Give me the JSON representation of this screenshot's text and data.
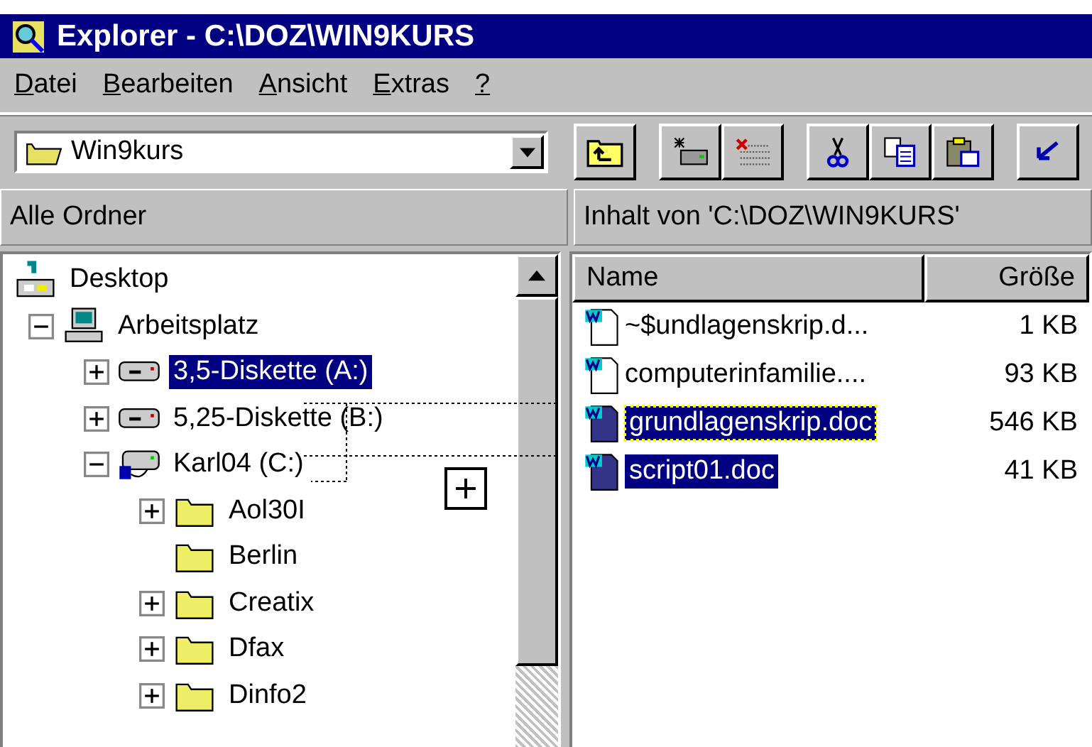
{
  "window": {
    "title": "Explorer - C:\\DOZ\\WIN9KURS"
  },
  "menu": [
    {
      "accelerator": "D",
      "rest": "atei"
    },
    {
      "accelerator": "B",
      "rest": "earbeiten"
    },
    {
      "accelerator": "A",
      "rest": "nsicht"
    },
    {
      "accelerator": "E",
      "rest": "xtras"
    },
    {
      "accelerator": "?"
    }
  ],
  "address": {
    "value": "Win9kurs"
  },
  "tree_header": "Alle Ordner",
  "content_header": "Inhalt von 'C:\\DOZ\\WIN9KURS'",
  "tree": [
    {
      "label": "Desktop",
      "kind": "desktop",
      "selected": false,
      "children": [
        {
          "label": "Arbeitsplatz",
          "kind": "computer",
          "selected": false,
          "expanded": true,
          "children": [
            {
              "label": "3,5-Diskette (A:)",
              "kind": "floppy",
              "selected": true,
              "expanded": false
            },
            {
              "label": "5,25-Diskette (B:)",
              "kind": "floppy",
              "selected": false,
              "expanded": false
            },
            {
              "label": "Karl04 (C:)",
              "kind": "harddisk",
              "selected": false,
              "expanded": true,
              "children": [
                {
                  "label": "Aol30I",
                  "kind": "folder",
                  "selected": false,
                  "expanded": false
                },
                {
                  "label": "Berlin",
                  "kind": "folder",
                  "selected": false
                },
                {
                  "label": "Creatix",
                  "kind": "folder",
                  "selected": false,
                  "expanded": false
                },
                {
                  "label": "Dfax",
                  "kind": "folder",
                  "selected": false,
                  "expanded": false
                },
                {
                  "label": "Dinfo2",
                  "kind": "folder",
                  "selected": false,
                  "expanded": false
                }
              ]
            }
          ]
        }
      ]
    }
  ],
  "columns": [
    "Name",
    "Größe"
  ],
  "files": [
    {
      "name": "~$undlagenskrip.d...",
      "size": "1 KB",
      "selected": false,
      "focused": false
    },
    {
      "name": "computerinfamilie....",
      "size": "93 KB",
      "selected": false,
      "focused": false
    },
    {
      "name": "grundlagenskrip.doc",
      "size": "546 KB",
      "selected": true,
      "focused": true
    },
    {
      "name": "script01.doc",
      "size": "41 KB",
      "selected": true,
      "focused": false
    }
  ]
}
